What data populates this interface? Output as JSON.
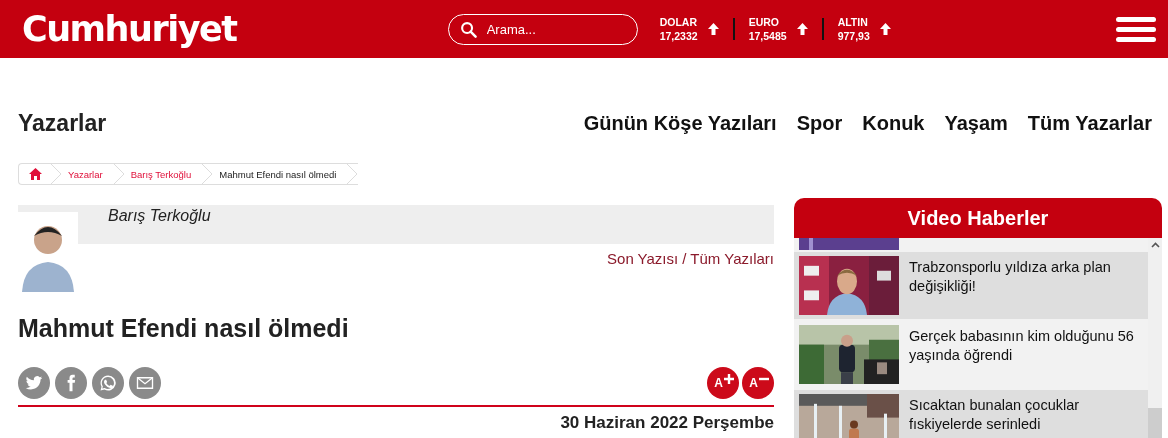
{
  "header": {
    "logo": "Cumhuriyet",
    "search": {
      "placeholder": "Arama..."
    },
    "rates": [
      {
        "name": "DOLAR",
        "value": "17,2332"
      },
      {
        "name": "EURO",
        "value": "17,5485"
      },
      {
        "name": "ALTIN",
        "value": "977,93"
      }
    ]
  },
  "section": {
    "title": "Yazarlar",
    "links": [
      "Günün Köşe Yazıları",
      "Spor",
      "Konuk",
      "Yaşam",
      "Tüm Yazarlar"
    ]
  },
  "breadcrumb": [
    {
      "label": "Yazarlar",
      "current": false
    },
    {
      "label": "Barış Terkoğlu",
      "current": false
    },
    {
      "label": "Mahmut Efendi nasıl ölmedi",
      "current": true
    }
  ],
  "author": {
    "name": "Barış Terkoğlu",
    "links": [
      "Son Yazısı",
      "Tüm Yazıları"
    ],
    "separator": "/"
  },
  "article": {
    "title": "Mahmut Efendi nasıl ölmedi",
    "share": [
      {
        "kind": "twitter"
      },
      {
        "kind": "facebook"
      },
      {
        "kind": "whatsapp"
      },
      {
        "kind": "mail"
      }
    ],
    "font_buttons": [
      {
        "kind": "increase",
        "label": "A"
      },
      {
        "kind": "decrease",
        "label": "A"
      }
    ],
    "date": "30 Haziran 2022 Perşembe"
  },
  "video": {
    "title": "Video Haberler",
    "items": [
      {
        "kind": "partial"
      },
      {
        "kind": "item",
        "title": "Trabzonsporlu yıldıza arka plan değişikliği!"
      },
      {
        "kind": "item",
        "title": "Gerçek babasının kim olduğunu 56 yaşında öğrendi"
      },
      {
        "kind": "item",
        "title": "Sıcaktan bunalan çocuklar fıskiyelerde serinledi"
      }
    ]
  }
}
